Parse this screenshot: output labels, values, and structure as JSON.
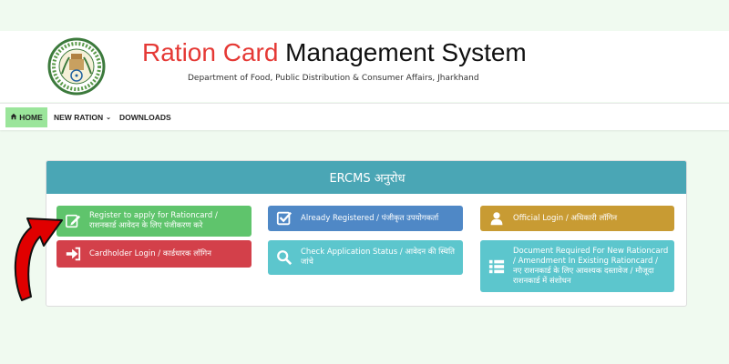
{
  "header": {
    "title_accent": "Ration Card",
    "title_rest": " Management System",
    "department": "Department of Food, Public Distribution & Consumer Affairs, Jharkhand"
  },
  "nav": {
    "home": "HOME",
    "new_ration": "NEW RATION",
    "downloads": "DOWNLOADS"
  },
  "panel": {
    "heading": "ERCMS अनुरोध"
  },
  "buttons": {
    "register": "Register to apply for Rationcard / राशनकार्ड आवेदन के लिए पंजीकरण करे",
    "cardholder": "Cardholder Login / कार्डधारक लॉगिन",
    "already": "Already Registered / पंजीकृत उपयोगकर्ता",
    "check": "Check Application Status / आवेदन की स्थिति जांचे",
    "official": "Official Login / अधिकारी लॉगिन",
    "documents": "Document Required For New Rationcard / Amendment In Existing Rationcard / नए राशनकार्ड के लिए आवश्यक दस्तावेज / मौजूदा राशनकार्ड में संशोधन"
  },
  "icons": {
    "emblem": "jharkhand-emblem",
    "home": "home-icon",
    "register": "edit-icon",
    "cardholder": "sign-in-icon",
    "already": "check-square-icon",
    "check": "search-icon",
    "official": "user-icon",
    "documents": "list-icon"
  },
  "colors": {
    "accent_red": "#e53935",
    "nav_active": "#9be59b",
    "panel_header": "#4aa6b5",
    "register_green": "#5fc46c",
    "cardholder_red": "#d3404a",
    "already_blue": "#4f88c6",
    "check_teal": "#5cc6cd",
    "official_gold": "#c89b33",
    "annotation_arrow": "#e00000"
  }
}
